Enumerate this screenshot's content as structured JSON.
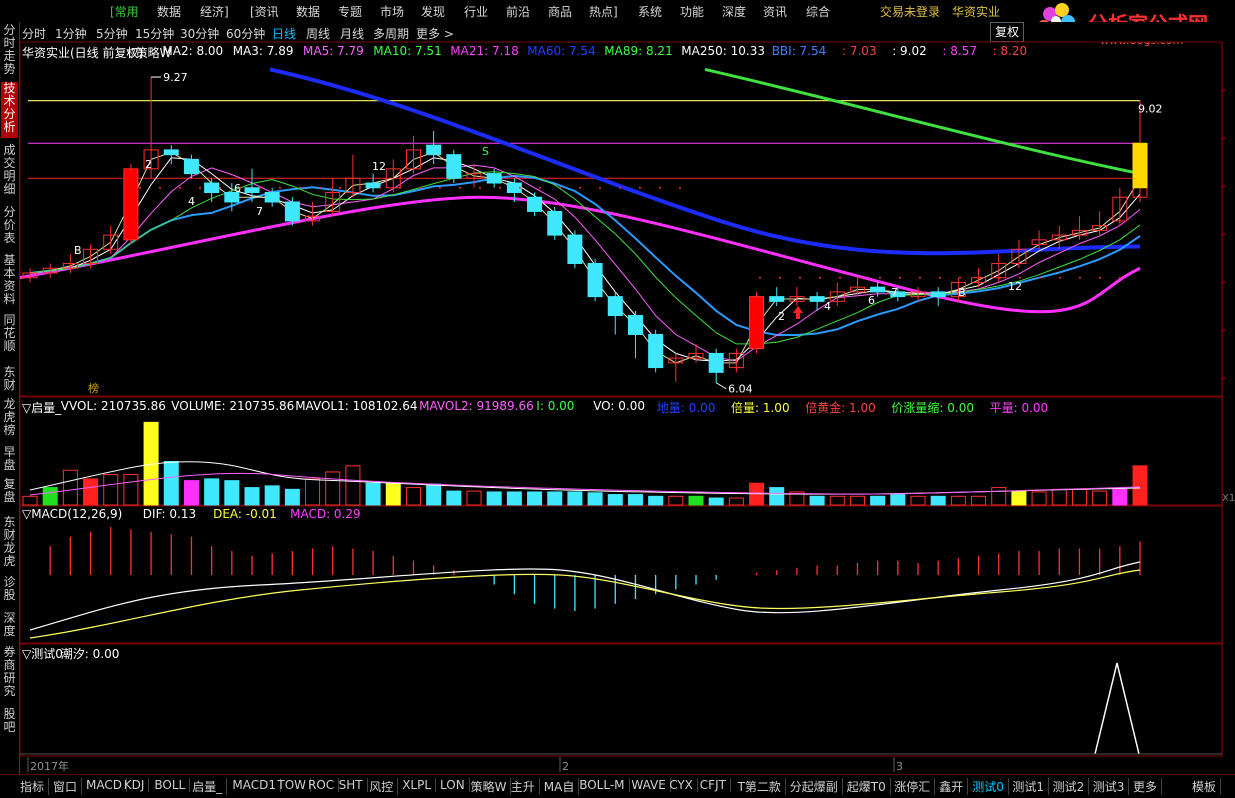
{
  "top_menu": {
    "items": [
      "[常用",
      "数据",
      "经济]",
      "[资讯",
      "数据",
      "专题",
      "市场",
      "发现",
      "行业",
      "前沿",
      "商品",
      "热点]",
      "系统",
      "功能",
      "深度",
      "资讯",
      "综合"
    ],
    "login": "交易未登录",
    "stock_name": "华资实业"
  },
  "logo": {
    "text": "分析家公式网",
    "url": "www.88gs.com"
  },
  "sidebar": {
    "items": [
      "分时走势",
      "技术分析",
      "成交明细",
      "分价表",
      "基本资料",
      "同花顺",
      "东财",
      "龙虎榜",
      "早盘",
      "复盘",
      "东财龙虎",
      "诊股",
      "深度",
      "券商研究",
      "股吧"
    ],
    "active_index": 1
  },
  "period_bar": {
    "items": [
      "分时",
      "1分钟",
      "5分钟",
      "15分钟",
      "30分钟",
      "60分钟",
      "日线",
      "周线",
      "月线",
      "多周期",
      "更多 >"
    ],
    "active_index": 6,
    "fuquan_label": "复权"
  },
  "main_panel": {
    "title": "华资实业(日线 前复权)",
    "strategy": "▽策略W",
    "indicators": [
      {
        "label": "MA2: 8.00",
        "color": "#ffffff"
      },
      {
        "label": "MA3: 7.89",
        "color": "#ffffff"
      },
      {
        "label": "MA5: 7.79",
        "color": "#ff60ff"
      },
      {
        "label": "MA10: 7.51",
        "color": "#40ff40"
      },
      {
        "label": "MA21: 7.18",
        "color": "#ff40ff"
      },
      {
        "label": "MA60: 7.54",
        "color": "#2040ff"
      },
      {
        "label": "MA89: 8.21",
        "color": "#40ff40"
      },
      {
        "label": "MA250: 10.33",
        "color": "#ffffff"
      },
      {
        "label": "BBI: 7.54",
        "color": "#4080ff"
      },
      {
        "label": ": 7.03",
        "color": "#ff4040"
      },
      {
        "label": ": 9.02",
        "color": "#ffffff"
      },
      {
        "label": ": 8.57",
        "color": "#ff40ff"
      },
      {
        "label": ": 8.20",
        "color": "#ff4040"
      }
    ],
    "high_label": "9.27",
    "low_label": "6.04",
    "right_label": "9.02",
    "markers": [
      "2",
      "4",
      "6",
      "7",
      "12",
      "S",
      "B",
      "2",
      "4",
      "6",
      "7",
      "B",
      "12"
    ],
    "bang_label": "榜"
  },
  "volume_panel": {
    "title": "▽启量_",
    "indicators": [
      {
        "label": "VVOL: 210735.86",
        "color": "#ffffff"
      },
      {
        "label": "VOLUME: 210735.86",
        "color": "#ffffff"
      },
      {
        "label": "MAVOL1: 108102.64",
        "color": "#ffffff"
      },
      {
        "label": "MAVOL2: 91989.66",
        "color": "#ff60ff"
      },
      {
        "label": "I: 0.00",
        "color": "#40ff40"
      },
      {
        "label": "VO: 0.00",
        "color": "#ffffff"
      },
      {
        "label": "地量: 0.00",
        "color": "#2040ff"
      },
      {
        "label": "倍量: 1.00",
        "color": "#ffff40"
      },
      {
        "label": "倍黄金: 1.00",
        "color": "#ff4040"
      },
      {
        "label": "价涨量缩: 0.00",
        "color": "#40ff40"
      },
      {
        "label": "平量: 0.00",
        "color": "#ff40ff"
      }
    ],
    "scale_label": "X1"
  },
  "macd_panel": {
    "title": "▽MACD(12,26,9)",
    "indicators": [
      {
        "label": "DIF: 0.13",
        "color": "#ffffff"
      },
      {
        "label": "DEA: -0.01",
        "color": "#ffff40"
      },
      {
        "label": "MACD: 0.29",
        "color": "#ff40ff"
      }
    ]
  },
  "test_panel": {
    "title": "▽测试0",
    "indicators": [
      {
        "label": "潮汐: 0.00",
        "color": "#ffffff"
      }
    ]
  },
  "date_axis": {
    "labels": [
      "2017年",
      "2",
      "3"
    ]
  },
  "bottom_tabs": {
    "items": [
      "指标",
      "窗口",
      "MACD",
      "KDJ",
      "BOLL",
      "启量_",
      "MACD1",
      "TOW",
      "ROC",
      "SHT",
      "风控",
      "XLPL",
      "LON",
      "策略W",
      "主升",
      "MA自",
      "BOLL-M",
      "WAVE",
      "CYX",
      "CFJT",
      "T第二款",
      "分起爆副",
      "起爆T0",
      "涨停汇",
      "鑫开",
      "测试0",
      "测试1",
      "测试2",
      "测试3",
      "更多",
      "模板"
    ],
    "active_index": 25
  },
  "chart_data": {
    "type": "candlestick",
    "candles": [
      [
        7.15,
        7.2,
        7.25,
        7.1
      ],
      [
        7.2,
        7.25,
        7.3,
        7.15
      ],
      [
        7.25,
        7.3,
        7.4,
        7.2
      ],
      [
        7.3,
        7.45,
        7.5,
        7.25
      ],
      [
        7.45,
        7.6,
        7.7,
        7.4
      ],
      [
        7.55,
        8.3,
        8.35,
        7.5
      ],
      [
        8.3,
        8.5,
        9.27,
        8.2
      ],
      [
        8.5,
        8.45,
        8.55,
        8.35
      ],
      [
        8.4,
        8.25,
        8.45,
        8.2
      ],
      [
        8.15,
        8.05,
        8.2,
        7.95
      ],
      [
        8.05,
        7.95,
        8.15,
        7.85
      ],
      [
        8.1,
        8.05,
        8.3,
        7.95
      ],
      [
        8.05,
        7.95,
        8.1,
        7.9
      ],
      [
        7.95,
        7.75,
        8.0,
        7.7
      ],
      [
        7.75,
        7.8,
        7.95,
        7.7
      ],
      [
        7.85,
        8.05,
        8.2,
        7.8
      ],
      [
        8.05,
        8.2,
        8.45,
        8.0
      ],
      [
        8.15,
        8.1,
        8.25,
        8.05
      ],
      [
        8.1,
        8.3,
        8.4,
        8.05
      ],
      [
        8.3,
        8.5,
        8.65,
        8.25
      ],
      [
        8.55,
        8.45,
        8.7,
        8.35
      ],
      [
        8.45,
        8.2,
        8.5,
        8.15
      ],
      [
        8.2,
        8.25,
        8.35,
        8.1
      ],
      [
        8.25,
        8.15,
        8.3,
        8.1
      ],
      [
        8.15,
        8.05,
        8.2,
        7.95
      ],
      [
        8.0,
        7.85,
        8.05,
        7.8
      ],
      [
        7.85,
        7.6,
        7.9,
        7.55
      ],
      [
        7.6,
        7.3,
        7.65,
        7.25
      ],
      [
        7.3,
        6.95,
        7.35,
        6.9
      ],
      [
        6.95,
        6.75,
        7.0,
        6.55
      ],
      [
        6.75,
        6.55,
        6.8,
        6.3
      ],
      [
        6.55,
        6.2,
        6.6,
        6.15
      ],
      [
        6.25,
        6.3,
        6.35,
        6.05
      ],
      [
        6.3,
        6.35,
        6.45,
        6.25
      ],
      [
        6.35,
        6.15,
        6.4,
        6.04
      ],
      [
        6.2,
        6.35,
        6.4,
        6.15
      ],
      [
        6.4,
        6.95,
        7.0,
        6.35
      ],
      [
        6.95,
        6.9,
        7.05,
        6.85
      ],
      [
        6.9,
        6.95,
        7.05,
        6.85
      ],
      [
        6.95,
        6.9,
        7.0,
        6.8
      ],
      [
        6.9,
        7.0,
        7.1,
        6.85
      ],
      [
        7.0,
        7.05,
        7.15,
        6.95
      ],
      [
        7.05,
        7.0,
        7.1,
        6.95
      ],
      [
        7.0,
        6.95,
        7.05,
        6.9
      ],
      [
        6.95,
        7.0,
        7.05,
        6.9
      ],
      [
        7.0,
        6.95,
        7.05,
        6.85
      ],
      [
        6.95,
        7.1,
        7.15,
        6.9
      ],
      [
        7.1,
        7.15,
        7.25,
        7.05
      ],
      [
        7.15,
        7.3,
        7.4,
        7.1
      ],
      [
        7.3,
        7.45,
        7.55,
        7.25
      ],
      [
        7.5,
        7.55,
        7.65,
        7.45
      ],
      [
        7.55,
        7.6,
        7.7,
        7.45
      ],
      [
        7.6,
        7.65,
        7.8,
        7.55
      ],
      [
        7.65,
        7.7,
        7.85,
        7.6
      ],
      [
        7.75,
        8.0,
        8.1,
        7.7
      ],
      [
        8.0,
        8.4,
        9.02,
        7.95
      ]
    ],
    "candle_fields": [
      "open",
      "close",
      "high",
      "low"
    ],
    "ylim": [
      5.9,
      9.45
    ],
    "volume_note": "volume bars shown without numeric scale",
    "high": 9.27,
    "low": 6.04,
    "ref_line": 9.02
  }
}
